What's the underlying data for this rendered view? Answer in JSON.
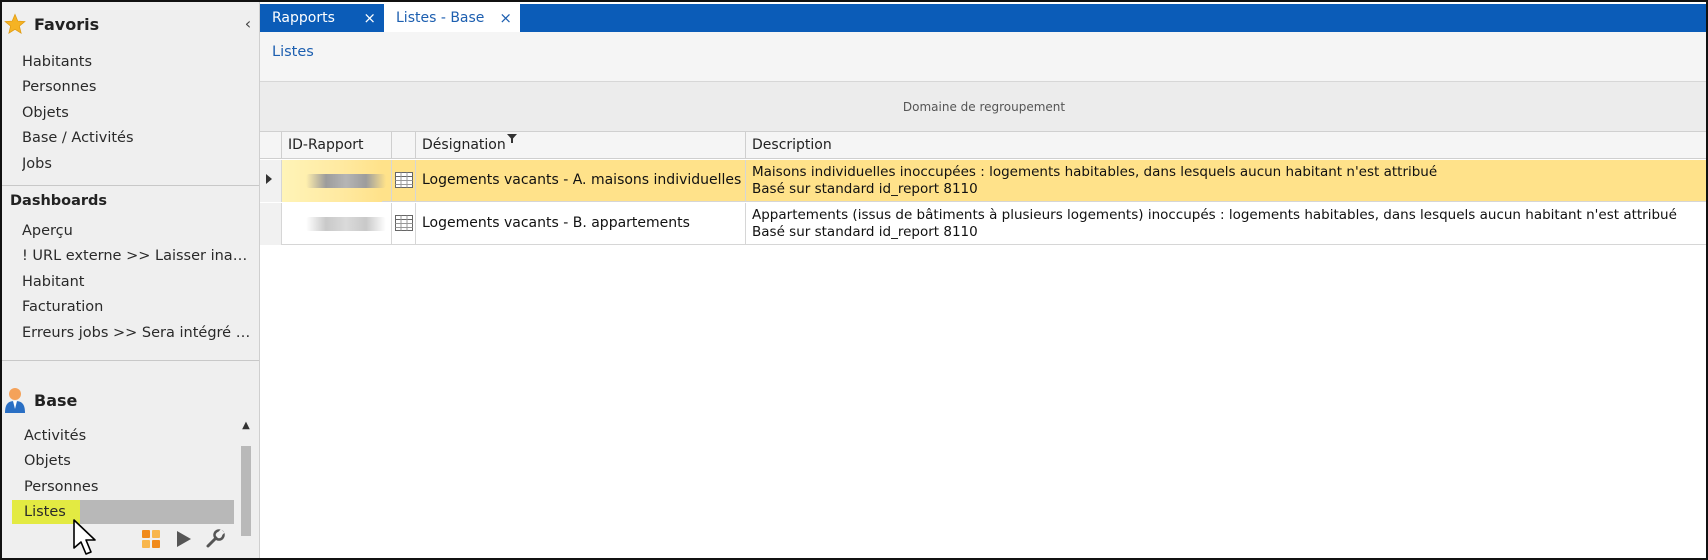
{
  "sidebar": {
    "favoris": {
      "title": "Favoris",
      "icon": "star-icon",
      "collapse_glyph": "‹",
      "items": [
        "Habitants",
        "Personnes",
        "Objets",
        "Base / Activités",
        "Jobs"
      ]
    },
    "dashboards": {
      "title": "Dashboards",
      "items": [
        "Aperçu",
        "! URL externe >> Laisser inactif...",
        "Habitant",
        "Facturation",
        "Erreurs jobs >> Sera intégré da..."
      ]
    },
    "base": {
      "title": "Base",
      "icon": "person-icon",
      "items": [
        "Activités",
        "Objets",
        "Personnes",
        "Listes"
      ],
      "selected": "Listes"
    },
    "toolbar_icons": [
      "layout-icon",
      "play-icon",
      "wrench-icon"
    ],
    "highlight_color": "#e3ea42"
  },
  "tabs": [
    {
      "label": "Rapports",
      "close": "×",
      "active": false
    },
    {
      "label": "Listes - Base",
      "close": "×",
      "active": true
    }
  ],
  "breadcrumb": "Listes",
  "grouping_area": "Domaine de regroupement",
  "grid": {
    "columns": [
      "ID-Rapport",
      "Désignation",
      "Description"
    ],
    "rows": [
      {
        "id": "",
        "designation": "Logements vacants - A. maisons individuelles",
        "description_line1": "Maisons individuelles inoccupées : logements habitables, dans lesquels aucun habitant n'est attribué",
        "description_line2": "Basé sur standard id_report 8110",
        "selected": true
      },
      {
        "id": "",
        "designation": "Logements vacants - B. appartements",
        "description_line1": "Appartements (issus de bâtiments à plusieurs logements) inoccupés : logements habitables, dans lesquels aucun habitant n'est attribué",
        "description_line2": "Basé sur standard id_report 8110",
        "selected": false
      }
    ]
  },
  "colors": {
    "tab_bar": "#0b5cb8",
    "link": "#1d5fb0",
    "selected_row": "#ffe28a"
  }
}
